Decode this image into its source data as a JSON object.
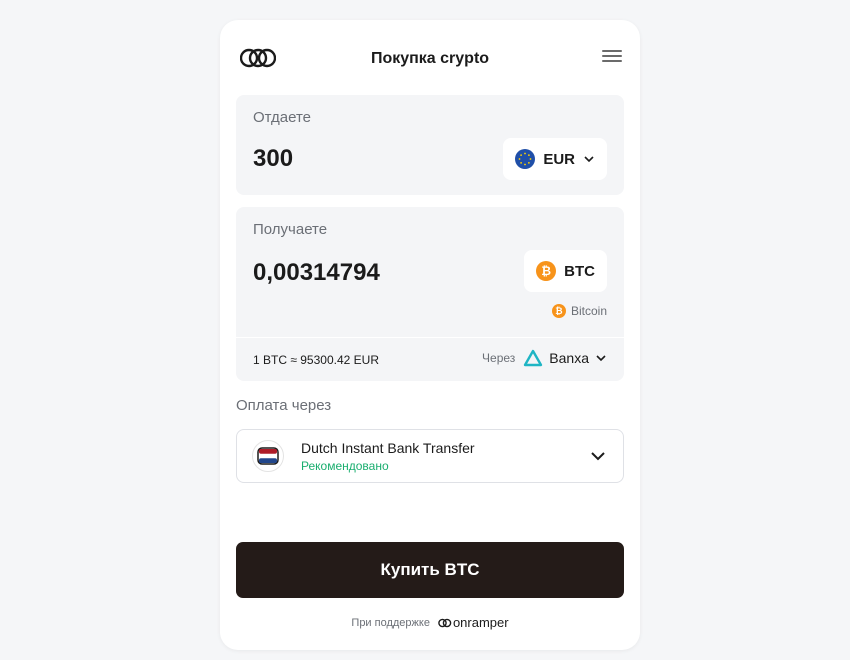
{
  "header": {
    "title": "Покупка crypto",
    "logo_icon": "onramper-logo-icon",
    "menu_icon": "hamburger-menu-icon"
  },
  "send": {
    "label": "Отдаете",
    "amount": "300",
    "currency": "EUR",
    "currency_icon": "eu-flag-icon"
  },
  "receive": {
    "label": "Получаете",
    "amount": "0,00314794",
    "currency": "BTC",
    "network": "Bitcoin",
    "currency_icon": "bitcoin-icon"
  },
  "quote": {
    "rate": "1 BTC ≈ 95300.42 EUR",
    "via_label": "Через",
    "provider": "Banxa",
    "provider_icon": "banxa-logo-icon"
  },
  "payment": {
    "label": "Оплата через",
    "method": "Dutch Instant Bank Transfer",
    "tag": "Рекомендовано",
    "method_icon": "netherlands-flag-icon"
  },
  "buy_button": {
    "label": "Купить BTC"
  },
  "footer": {
    "powered_by": "При поддержке",
    "brand": "onramper"
  },
  "colors": {
    "background": "#f5f6f8",
    "panel": "#f4f5f7",
    "button": "#241b18",
    "recommended": "#1aae6f",
    "bitcoin": "#f7931a",
    "eur": "#1f4fa8",
    "banxa": "#1fb5c4"
  }
}
